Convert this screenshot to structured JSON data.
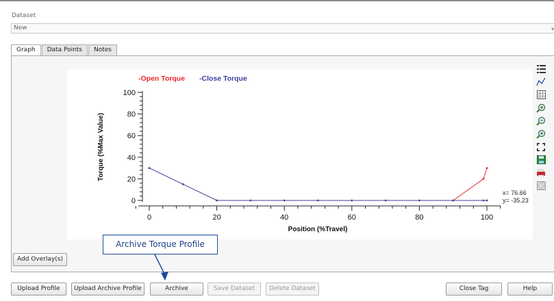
{
  "dataset": {
    "label": "Dataset",
    "value": "New"
  },
  "tabs": [
    {
      "label": "Graph",
      "active": true
    },
    {
      "label": "Data Points",
      "active": false
    },
    {
      "label": "Notes",
      "active": false
    }
  ],
  "chart_data": {
    "type": "line",
    "xlabel": "Position (%Travel)",
    "ylabel": "Torque (%Max Value)",
    "xlim": [
      0,
      100
    ],
    "ylim": [
      0,
      100
    ],
    "xticks": [
      "0",
      "20",
      "40",
      "60",
      "80",
      "100"
    ],
    "yticks": [
      "0",
      "20",
      "40",
      "60",
      "80",
      "100"
    ],
    "legend_position": "top",
    "series": [
      {
        "name": "-Open Torque",
        "color": "#e8282c",
        "x": [
          90,
          99,
          100
        ],
        "y": [
          0,
          20,
          30
        ]
      },
      {
        "name": "-Close Torque",
        "color": "#3b3f99",
        "x": [
          0,
          10,
          20,
          30,
          40,
          50,
          60,
          70,
          80,
          90,
          99,
          100
        ],
        "y": [
          30,
          15,
          0,
          0,
          0,
          0,
          0,
          0,
          0,
          0,
          0,
          0
        ]
      }
    ],
    "cursor": {
      "x_text": "x= 76.66",
      "y_text": "y= -35.23"
    }
  },
  "toolbar_icons": [
    "legend-icon",
    "line-style-icon",
    "grid-icon",
    "zoom-in-icon",
    "zoom-out-icon",
    "zoom-reset-icon",
    "fit-icon",
    "save-icon",
    "print-icon",
    "export-icon"
  ],
  "buttons": {
    "add_overlay": "Add Overlay(s)",
    "upload_profile": "Upload Profile",
    "upload_archive_profile": "Upload Archive Profile",
    "archive": "Archive",
    "save_dataset": "Save Dataset",
    "delete_dataset": "Delete Dataset",
    "close_tag": "Close Tag",
    "help": "Help"
  },
  "callout": {
    "text": "Archive Torque Profile",
    "color": "#1e4a9c"
  }
}
